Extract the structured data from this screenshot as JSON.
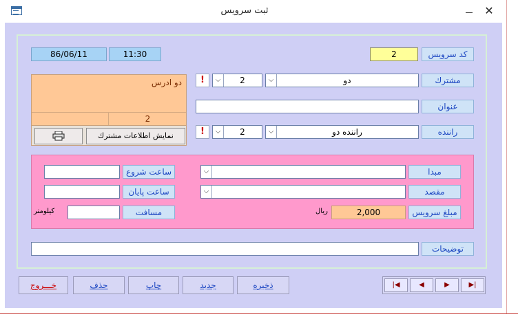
{
  "window": {
    "title": "ثبت سرويس",
    "close_glyph": "✕"
  },
  "header": {
    "date": "86/06/11",
    "time": "11:30"
  },
  "form": {
    "service_code": {
      "label": "كد سرويس",
      "value": "2"
    },
    "customer": {
      "label": "مشترك",
      "code": "2",
      "name": "دو"
    },
    "title": {
      "label": "عنوان",
      "value": ""
    },
    "driver": {
      "label": "راننده",
      "code": "2",
      "name": "راننده دو"
    },
    "address": {
      "text": "دو ادرس",
      "number": "2"
    },
    "show_customer_button": "نمايش اطلاعات مشترك",
    "warn_glyph": "!",
    "origin": {
      "label": "مبدا",
      "value": ""
    },
    "destination": {
      "label": "مقصد",
      "value": ""
    },
    "start_time": {
      "label": "ساعت شروع",
      "value": ""
    },
    "end_time": {
      "label": "ساعت پايان",
      "value": ""
    },
    "distance": {
      "label": "مسافت",
      "value": "",
      "unit": "كيلومتر"
    },
    "service_amount": {
      "label": "مبلغ سرويس",
      "value": "2,000",
      "unit": "ريال"
    },
    "notes": {
      "label": "توضيحات",
      "value": ""
    }
  },
  "footer": {
    "save": "ذخيره",
    "new": "جديد",
    "print": "چاپ",
    "delete": "حذف",
    "exit": "خـــروج"
  },
  "nav": {
    "first": "|◀",
    "prev": "◀",
    "next": "▶",
    "last": "▶|"
  },
  "colors": {
    "label_bg": "#cfe3f7",
    "client_bg": "#cfcff5",
    "pink_panel": "#ff99cc",
    "peach": "#ffc896"
  }
}
